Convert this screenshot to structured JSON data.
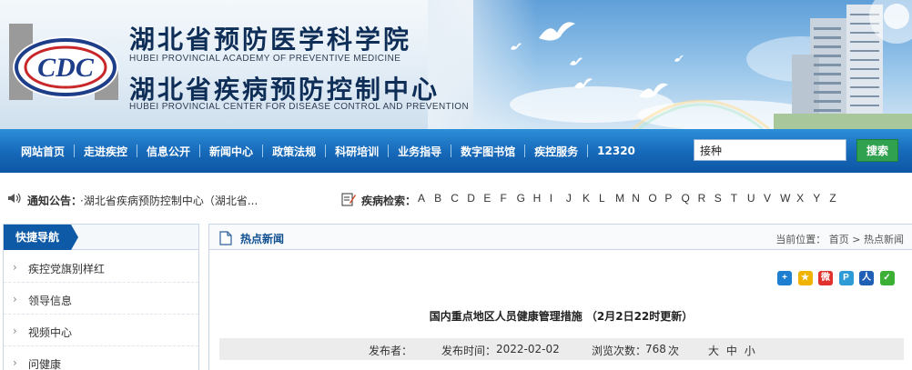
{
  "header": {
    "title_cn_1": "湖北省预防医学科学院",
    "title_en_1": "HUBEI PROVINCIAL ACADEMY OF PREVENTIVE MEDICINE",
    "title_cn_2": "湖北省疾病预防控制中心",
    "title_en_2": "HUBEI PROVINCIAL CENTER FOR DISEASE CONTROL AND PREVENTION",
    "logo_text": "CDC"
  },
  "nav": {
    "items": [
      {
        "label": "网站首页"
      },
      {
        "label": "走进疾控"
      },
      {
        "label": "信息公开"
      },
      {
        "label": "新闻中心"
      },
      {
        "label": "政策法规"
      },
      {
        "label": "科研培训"
      },
      {
        "label": "业务指导"
      },
      {
        "label": "数字图书馆"
      },
      {
        "label": "疾控服务"
      },
      {
        "label": "12320"
      }
    ],
    "search_value": "接种",
    "search_button": "搜索"
  },
  "notice": {
    "label": "通知公告：",
    "text": "·湖北省疾病预防控制中心（湖北省...",
    "disease_label": "疾病检索：",
    "letters": [
      "A",
      "B",
      "C",
      "D",
      "E",
      "F",
      "G",
      "H",
      "I",
      "J",
      "K",
      "L",
      "M",
      "N",
      "O",
      "P",
      "Q",
      "R",
      "S",
      "T",
      "U",
      "V",
      "W",
      "X",
      "Y",
      "Z"
    ]
  },
  "sidebar": {
    "title": "快捷导航",
    "items": [
      {
        "label": "疾控党旗别样红"
      },
      {
        "label": "领导信息"
      },
      {
        "label": "视频中心"
      },
      {
        "label": "问健康"
      }
    ]
  },
  "main": {
    "section_title": "热点新闻",
    "breadcrumb_prefix": "当前位置：",
    "breadcrumb_home": "首页",
    "breadcrumb_sep": ">",
    "breadcrumb_current": "热点新闻",
    "share_icons": [
      {
        "name": "share-more-icon",
        "glyph": "+",
        "color": "#1e7fd0"
      },
      {
        "name": "qzone-icon",
        "glyph": "★",
        "color": "#f0b400"
      },
      {
        "name": "weibo-icon",
        "glyph": "微",
        "color": "#e0312c"
      },
      {
        "name": "tencent-weibo-icon",
        "glyph": "P",
        "color": "#2f9bd6"
      },
      {
        "name": "renren-icon",
        "glyph": "人",
        "color": "#1f5fb5"
      },
      {
        "name": "wechat-icon",
        "glyph": "✓",
        "color": "#3cb034"
      }
    ],
    "article_title": "国内重点地区人员健康管理措施 （2月2日22时更新）",
    "publisher_label": "发布者：",
    "publish_time_label": "发布时间：",
    "publish_time": "2022-02-02",
    "views_label": "浏览次数：",
    "views": "768",
    "views_unit": "次",
    "font_large": "大",
    "font_medium": "中",
    "font_small": "小"
  }
}
